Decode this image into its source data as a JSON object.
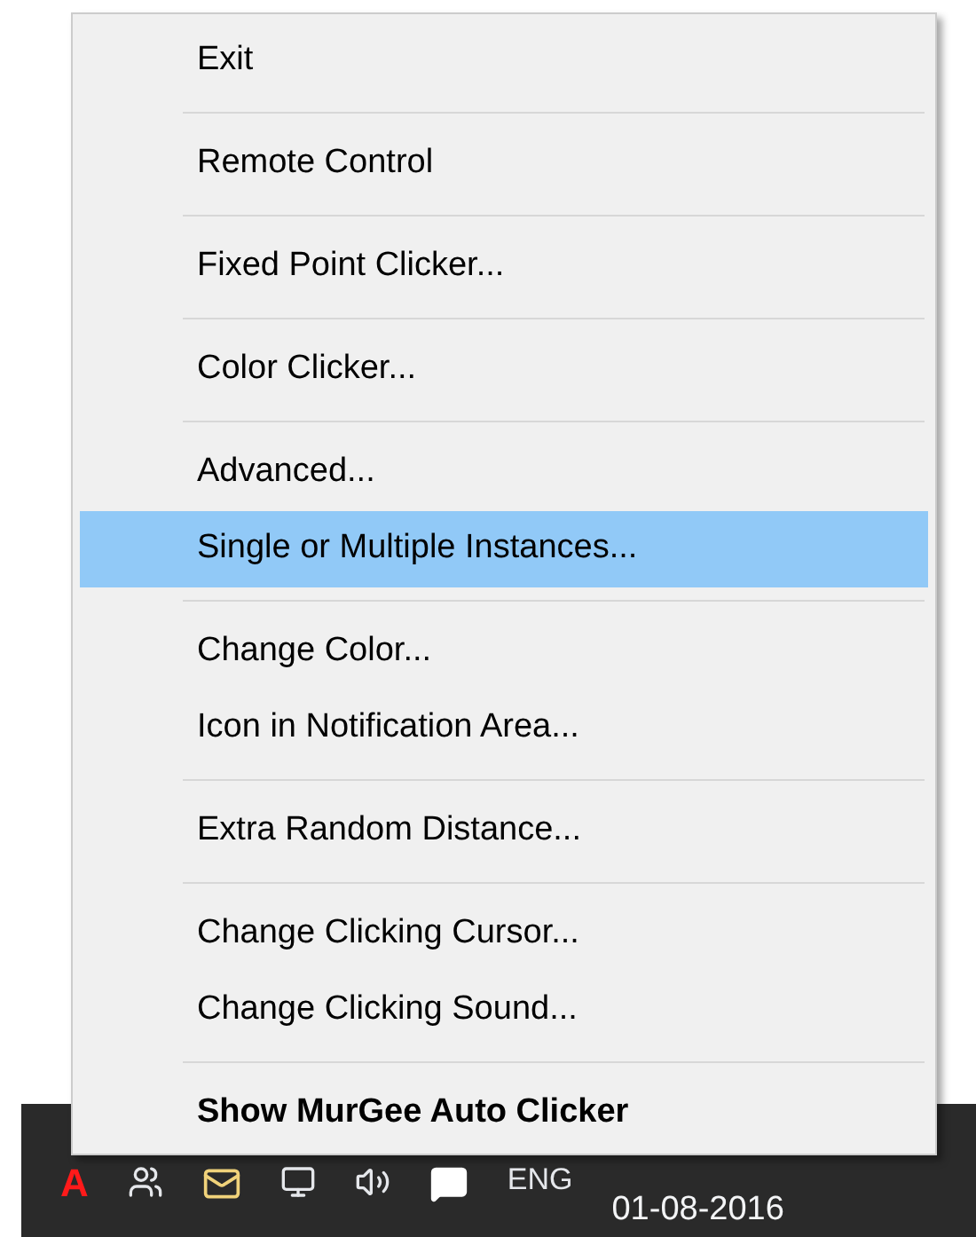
{
  "menu": {
    "groups": [
      [
        {
          "label": "Exit",
          "selected": false,
          "bold": false
        }
      ],
      [
        {
          "label": "Remote Control",
          "selected": false,
          "bold": false
        }
      ],
      [
        {
          "label": "Fixed Point Clicker...",
          "selected": false,
          "bold": false
        }
      ],
      [
        {
          "label": "Color Clicker...",
          "selected": false,
          "bold": false
        }
      ],
      [
        {
          "label": "Advanced...",
          "selected": false,
          "bold": false
        },
        {
          "label": "Single or Multiple Instances...",
          "selected": true,
          "bold": false
        }
      ],
      [
        {
          "label": "Change Color...",
          "selected": false,
          "bold": false
        },
        {
          "label": "Icon in Notification Area...",
          "selected": false,
          "bold": false
        }
      ],
      [
        {
          "label": "Extra Random Distance...",
          "selected": false,
          "bold": false
        }
      ],
      [
        {
          "label": "Change Clicking Cursor...",
          "selected": false,
          "bold": false
        },
        {
          "label": "Change Clicking Sound...",
          "selected": false,
          "bold": false
        }
      ],
      [
        {
          "label": "Show MurGee Auto Clicker",
          "selected": false,
          "bold": true
        }
      ]
    ]
  },
  "taskbar": {
    "app_letter": "A",
    "language": "ENG",
    "date": "01-08-2016"
  }
}
